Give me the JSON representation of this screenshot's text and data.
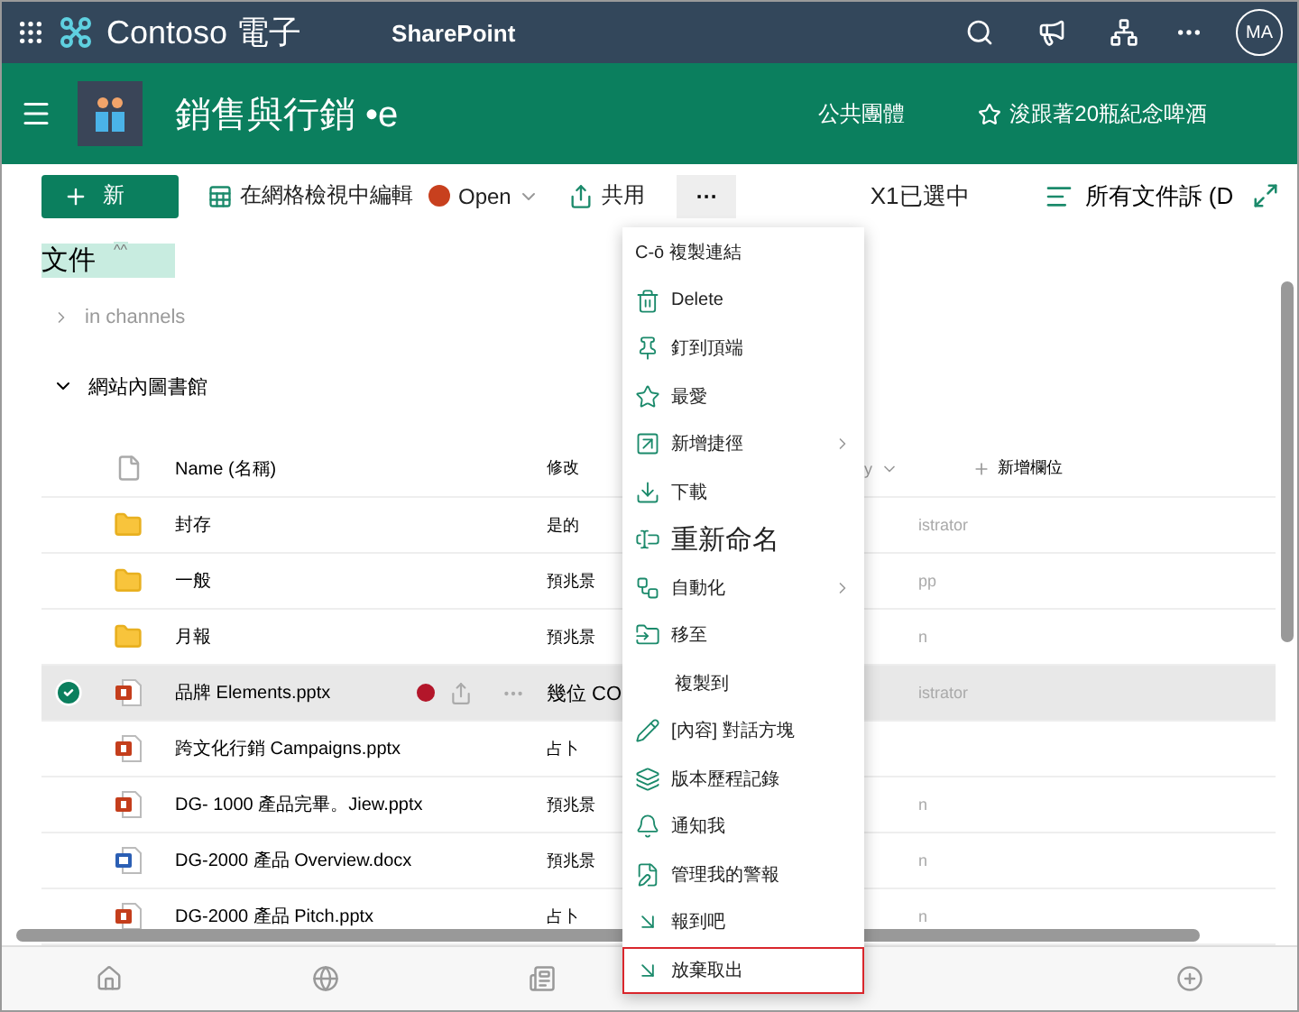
{
  "topbar": {
    "brand": "Contoso 電子",
    "app": "SharePoint",
    "avatar": "MA"
  },
  "site": {
    "title": "銷售與行銷 •e",
    "group": "公共團體",
    "follow": "浚跟著20瓶紀念啤酒"
  },
  "toolbar": {
    "new": "新",
    "grid_edit": "在網格檢視中編輯",
    "open": "Open",
    "share": "共用",
    "more": "···",
    "selection": "X1已選中",
    "view": "所有文件訴 (D"
  },
  "library": {
    "title": "文件",
    "title_mark": "^^",
    "channels": "in channels",
    "section": "網站內圖書館"
  },
  "table": {
    "columns": [
      {
        "label": "Name (名稱)"
      },
      {
        "label": "修改"
      },
      {
        "label": "y"
      },
      {
        "label": "新增欄位"
      }
    ],
    "rows": [
      {
        "kind": "folder",
        "name": "封存",
        "modified": "是的",
        "column_3": "istrator",
        "selected": false
      },
      {
        "kind": "folder",
        "name": "一般",
        "modified": "預兆景",
        "column_3": "pp",
        "selected": false
      },
      {
        "kind": "folder",
        "name": "月報",
        "modified": "預兆景",
        "column_3": "n",
        "selected": false
      },
      {
        "kind": "pptx",
        "name": "品牌 Elements.pptx",
        "modified": "幾位 CO",
        "column_3": "istrator",
        "selected": true
      },
      {
        "kind": "pptx",
        "name": "跨文化行銷 Campaigns.pptx",
        "modified": "占卜",
        "column_3": "",
        "selected": false
      },
      {
        "kind": "pptx",
        "name": "DG- 1000 產品完畢。Jiew.pptx",
        "modified": "預兆景",
        "column_3": "n",
        "selected": false
      },
      {
        "kind": "docx",
        "name": "DG-2000 產品 Overview.docx",
        "modified": "預兆景",
        "column_3": "n",
        "selected": false
      },
      {
        "kind": "pptx",
        "name": "DG-2000 產品 Pitch.pptx",
        "modified": "占卜",
        "column_3": "n",
        "selected": false
      }
    ]
  },
  "menu": [
    {
      "kind": "none",
      "label": "C-ō 複製連結",
      "submenu": false,
      "large": false,
      "selected": false
    },
    {
      "kind": "delete",
      "label": "Delete",
      "submenu": false,
      "large": false,
      "selected": false
    },
    {
      "kind": "pin",
      "label": "釘到頂端",
      "submenu": false,
      "large": false,
      "selected": false
    },
    {
      "kind": "star",
      "label": "最愛",
      "submenu": false,
      "large": false,
      "selected": false
    },
    {
      "kind": "shortcut",
      "label": "新增捷徑",
      "submenu": true,
      "large": false,
      "selected": false
    },
    {
      "kind": "download",
      "label": "下載",
      "submenu": false,
      "large": false,
      "selected": false
    },
    {
      "kind": "rename",
      "label": "重新命名",
      "submenu": false,
      "large": true,
      "selected": false
    },
    {
      "kind": "automate",
      "label": "自動化",
      "submenu": true,
      "large": false,
      "selected": false
    },
    {
      "kind": "move",
      "label": "移至",
      "submenu": false,
      "large": false,
      "selected": false
    },
    {
      "kind": "none",
      "label": "複製到",
      "submenu": false,
      "large": false,
      "selected": false
    },
    {
      "kind": "details",
      "label": "[內容] 對話方塊",
      "submenu": false,
      "large": false,
      "selected": false
    },
    {
      "kind": "versions",
      "label": "版本歷程記錄",
      "submenu": false,
      "large": false,
      "selected": false
    },
    {
      "kind": "alert",
      "label": "通知我",
      "submenu": false,
      "large": false,
      "selected": false
    },
    {
      "kind": "alerts",
      "label": "管理我的警報",
      "submenu": false,
      "large": false,
      "selected": false
    },
    {
      "kind": "checkin",
      "label": "報到吧",
      "submenu": false,
      "large": false,
      "selected": false
    },
    {
      "kind": "checkin",
      "label": "放棄取出",
      "submenu": false,
      "large": false,
      "selected": true
    }
  ]
}
